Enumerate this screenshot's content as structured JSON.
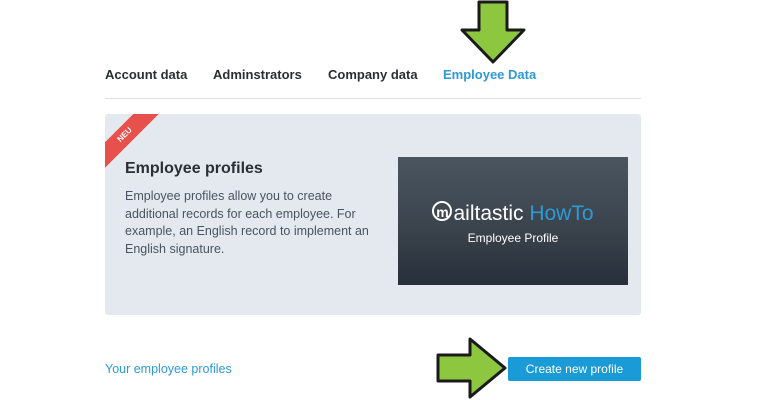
{
  "tabs": [
    {
      "label": "Account data"
    },
    {
      "label": "Adminstrators"
    },
    {
      "label": "Company data"
    },
    {
      "label": "Employee Data",
      "active": true
    }
  ],
  "card": {
    "badge": "NEU",
    "title": "Employee profiles",
    "description": "Employee profiles allow you to create additional records for each employee. For example, an English record to implement an English signature.",
    "video": {
      "logo_letter": "m",
      "brand": "ailtastic",
      "howto": " HowTo",
      "subtitle": "Employee Profile"
    }
  },
  "footer": {
    "link": "Your employee profiles",
    "button": "Create new profile"
  },
  "colors": {
    "accent": "#2d9ad6",
    "button": "#1a9ad6",
    "arrow": "#8dc63f",
    "badge": "#e8504b",
    "card_bg": "#e3e9ef"
  },
  "icons": [
    "arrow-down-icon",
    "arrow-right-icon"
  ]
}
